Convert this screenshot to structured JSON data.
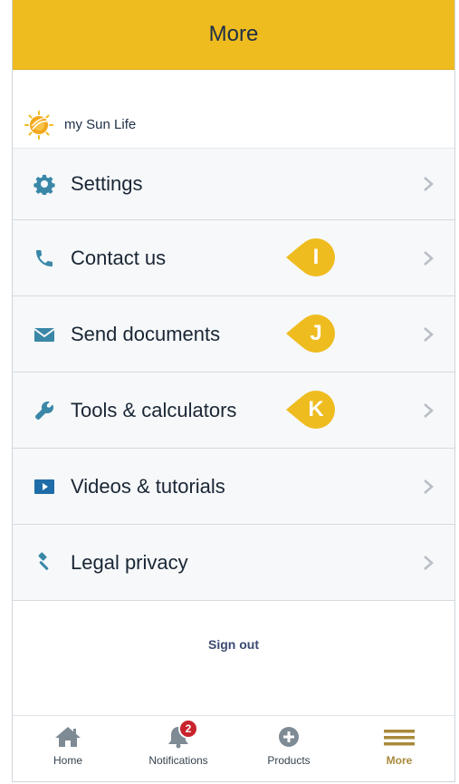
{
  "header": {
    "title": "More"
  },
  "brand": {
    "name": "my Sun Life",
    "logo_icon": "sun-life-logo-icon"
  },
  "menu": {
    "items": [
      {
        "label": "Settings",
        "icon": "gear-icon"
      },
      {
        "label": "Contact us",
        "icon": "phone-icon"
      },
      {
        "label": "Send documents",
        "icon": "envelope-icon"
      },
      {
        "label": "Tools & calculators",
        "icon": "wrench-icon"
      },
      {
        "label": "Videos & tutorials",
        "icon": "video-icon"
      },
      {
        "label": "Legal privacy",
        "icon": "gavel-icon"
      }
    ]
  },
  "callouts": [
    "I",
    "J",
    "K"
  ],
  "signout": {
    "label": "Sign out"
  },
  "tabbar": {
    "items": [
      {
        "label": "Home",
        "icon": "home-icon"
      },
      {
        "label": "Notifications",
        "icon": "bell-icon",
        "badge": "2"
      },
      {
        "label": "Products",
        "icon": "plus-circle-icon"
      },
      {
        "label": "More",
        "icon": "hamburger-icon",
        "active": true
      }
    ]
  },
  "colors": {
    "accent": "#efbc1f",
    "icon": "#3a87a8",
    "badge": "#c8232c",
    "active_tab": "#a88a3a"
  }
}
